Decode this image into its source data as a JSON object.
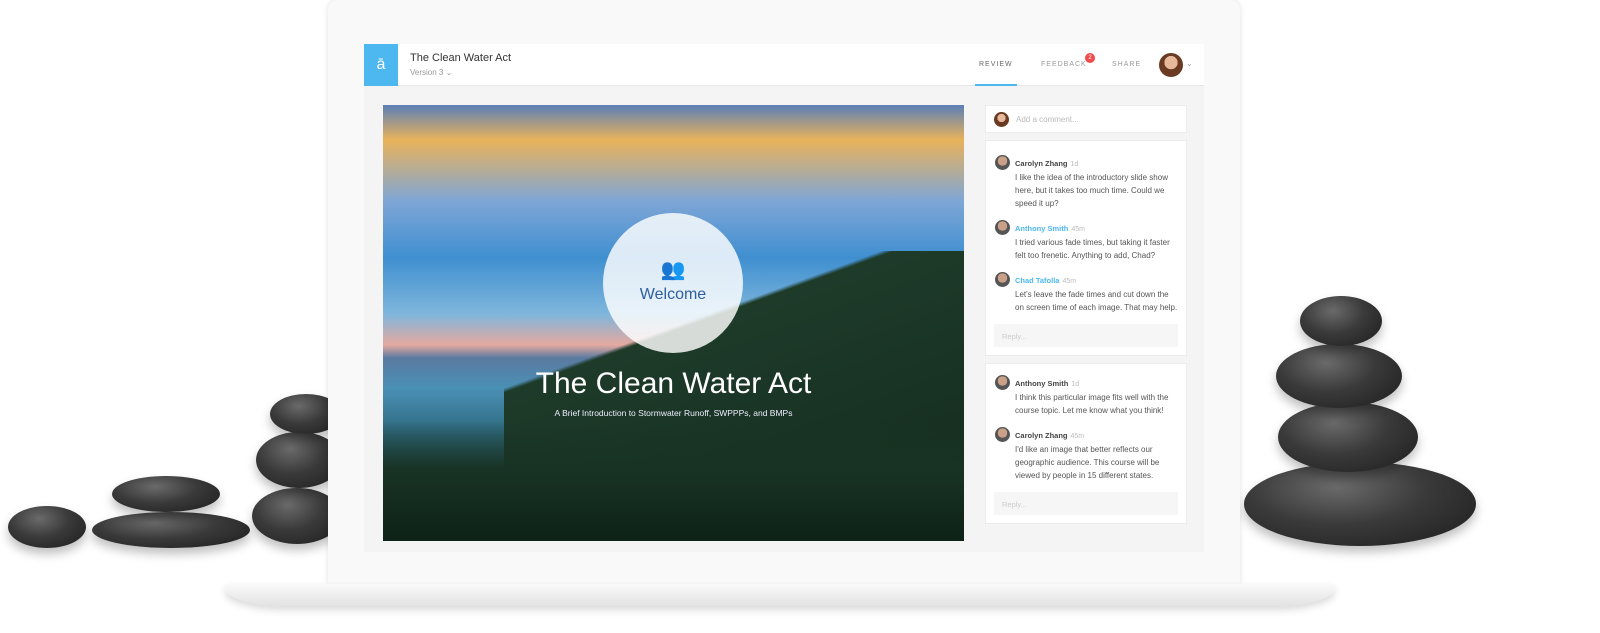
{
  "header": {
    "logo": "ā",
    "title": "The Clean Water Act",
    "version": "Version 3 ⌄",
    "tabs": [
      {
        "label": "REVIEW"
      },
      {
        "label": "FEEDBACK"
      },
      {
        "label": "SHARE"
      }
    ],
    "feedback_badge": "2",
    "menu_caret": "⌄"
  },
  "slide": {
    "icon": "group-icon",
    "welcome": "Welcome",
    "title": "The Clean Water Act",
    "subtitle": "A Brief Introduction to Stormwater Runoff, SWPPPs, and BMPs"
  },
  "sidebar": {
    "add_placeholder": "Add a comment...",
    "threads": [
      {
        "comments": [
          {
            "name": "Carolyn Zhang",
            "time": "1d",
            "text": "I like the idea of the introductory slide show here, but it takes too much time. Could we speed it up?"
          },
          {
            "name": "Anthony Smith",
            "time": "45m",
            "text": "I tried various fade times, but taking it faster felt too frenetic. Anything to add, Chad?"
          },
          {
            "name": "Chad Tafolla",
            "time": "45m",
            "text": "Let's leave the fade times and cut down the on screen time of each image. That may help."
          }
        ],
        "reply": "Reply..."
      },
      {
        "comments": [
          {
            "name": "Anthony Smith",
            "time": "1d",
            "text": "I think this particular image fits well with the course topic. Let me know what you think!"
          },
          {
            "name": "Carolyn Zhang",
            "time": "45m",
            "text": "I'd like an image that better reflects our geographic audience. This course will be viewed by people in 15 different states."
          }
        ],
        "reply": "Reply..."
      }
    ]
  },
  "colors": {
    "accent": "#4db8f0",
    "badge": "#f04b4b"
  }
}
